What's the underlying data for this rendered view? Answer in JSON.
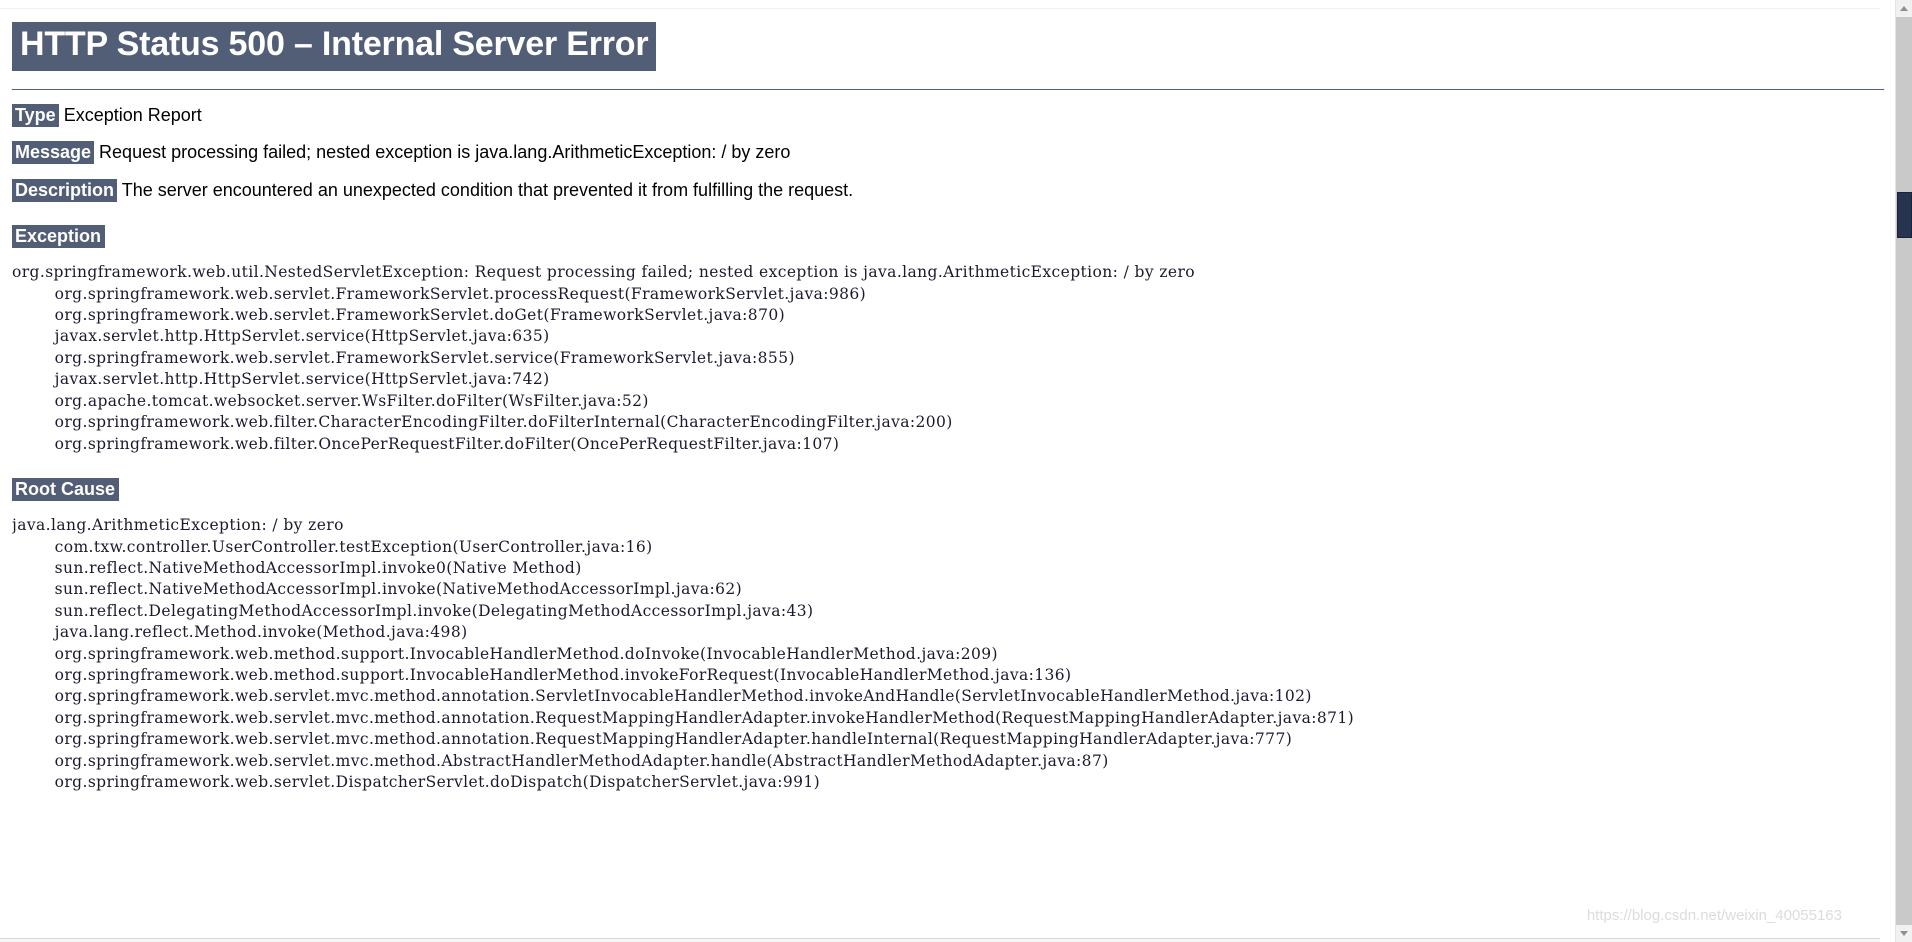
{
  "page": {
    "title": "HTTP Status 500 – Internal Server Error",
    "header_bg": "#525D76",
    "watermark": "https://blog.csdn.net/weixin_40055163"
  },
  "fields": {
    "type_label": "Type",
    "type_value": " Exception Report",
    "message_label": "Message",
    "message_value": " Request processing failed; nested exception is java.lang.ArithmeticException: / by zero",
    "description_label": "Description",
    "description_value": " The server encountered an unexpected condition that prevented it from fulfilling the request."
  },
  "sections": {
    "exception_label": "Exception",
    "root_cause_label": "Root Cause"
  },
  "exception_trace": "org.springframework.web.util.NestedServletException: Request processing failed; nested exception is java.lang.ArithmeticException: / by zero\n\torg.springframework.web.servlet.FrameworkServlet.processRequest(FrameworkServlet.java:986)\n\torg.springframework.web.servlet.FrameworkServlet.doGet(FrameworkServlet.java:870)\n\tjavax.servlet.http.HttpServlet.service(HttpServlet.java:635)\n\torg.springframework.web.servlet.FrameworkServlet.service(FrameworkServlet.java:855)\n\tjavax.servlet.http.HttpServlet.service(HttpServlet.java:742)\n\torg.apache.tomcat.websocket.server.WsFilter.doFilter(WsFilter.java:52)\n\torg.springframework.web.filter.CharacterEncodingFilter.doFilterInternal(CharacterEncodingFilter.java:200)\n\torg.springframework.web.filter.OncePerRequestFilter.doFilter(OncePerRequestFilter.java:107)",
  "root_cause_trace": "java.lang.ArithmeticException: / by zero\n\tcom.txw.controller.UserController.testException(UserController.java:16)\n\tsun.reflect.NativeMethodAccessorImpl.invoke0(Native Method)\n\tsun.reflect.NativeMethodAccessorImpl.invoke(NativeMethodAccessorImpl.java:62)\n\tsun.reflect.DelegatingMethodAccessorImpl.invoke(DelegatingMethodAccessorImpl.java:43)\n\tjava.lang.reflect.Method.invoke(Method.java:498)\n\torg.springframework.web.method.support.InvocableHandlerMethod.doInvoke(InvocableHandlerMethod.java:209)\n\torg.springframework.web.method.support.InvocableHandlerMethod.invokeForRequest(InvocableHandlerMethod.java:136)\n\torg.springframework.web.servlet.mvc.method.annotation.ServletInvocableHandlerMethod.invokeAndHandle(ServletInvocableHandlerMethod.java:102)\n\torg.springframework.web.servlet.mvc.method.annotation.RequestMappingHandlerAdapter.invokeHandlerMethod(RequestMappingHandlerAdapter.java:871)\n\torg.springframework.web.servlet.mvc.method.annotation.RequestMappingHandlerAdapter.handleInternal(RequestMappingHandlerAdapter.java:777)\n\torg.springframework.web.servlet.mvc.method.AbstractHandlerMethodAdapter.handle(AbstractHandlerMethodAdapter.java:87)\n\torg.springframework.web.servlet.DispatcherServlet.doDispatch(DispatcherServlet.java:991)"
}
